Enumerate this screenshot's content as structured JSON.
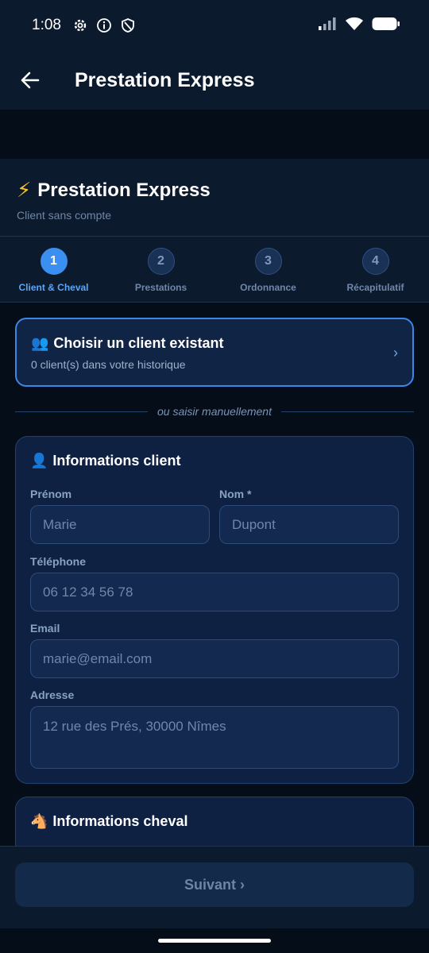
{
  "status_bar": {
    "time": "1:08",
    "icons": [
      "gear-icon",
      "info-icon",
      "shield-icon"
    ],
    "right_icons": [
      "signal-icon",
      "wifi-icon",
      "battery-icon"
    ]
  },
  "appbar": {
    "title": "Prestation Express"
  },
  "header": {
    "emoji": "⚡",
    "title": "Prestation Express",
    "subtitle": "Client sans compte"
  },
  "steps": [
    {
      "number": "1",
      "label": "Client & Cheval",
      "active": true
    },
    {
      "number": "2",
      "label": "Prestations",
      "active": false
    },
    {
      "number": "3",
      "label": "Ordonnance",
      "active": false
    },
    {
      "number": "4",
      "label": "Récapitulatif",
      "active": false
    }
  ],
  "existing_client": {
    "emoji": "👥",
    "title": "Choisir un client existant",
    "subtitle": "0 client(s) dans votre historique",
    "chevron": "›"
  },
  "divider": {
    "text": "ou saisir manuellement"
  },
  "client_form": {
    "emoji": "👤",
    "title": "Informations client",
    "first_name": {
      "label": "Prénom",
      "placeholder": "Marie",
      "value": ""
    },
    "last_name": {
      "label": "Nom *",
      "placeholder": "Dupont",
      "value": ""
    },
    "phone": {
      "label": "Téléphone",
      "placeholder": "06 12 34 56 78",
      "value": ""
    },
    "email": {
      "label": "Email",
      "placeholder": "marie@email.com",
      "value": ""
    },
    "address": {
      "label": "Adresse",
      "placeholder": "12 rue des Prés, 30000 Nîmes",
      "value": ""
    }
  },
  "horse_form": {
    "emoji": "🐴",
    "title": "Informations cheval"
  },
  "footer": {
    "next_label": "Suivant ›"
  },
  "colors": {
    "accent": "#3b8ff0",
    "background": "#050d19",
    "surface": "#0c1a2e",
    "card": "#0e2143",
    "bolt": "#f7c325"
  }
}
